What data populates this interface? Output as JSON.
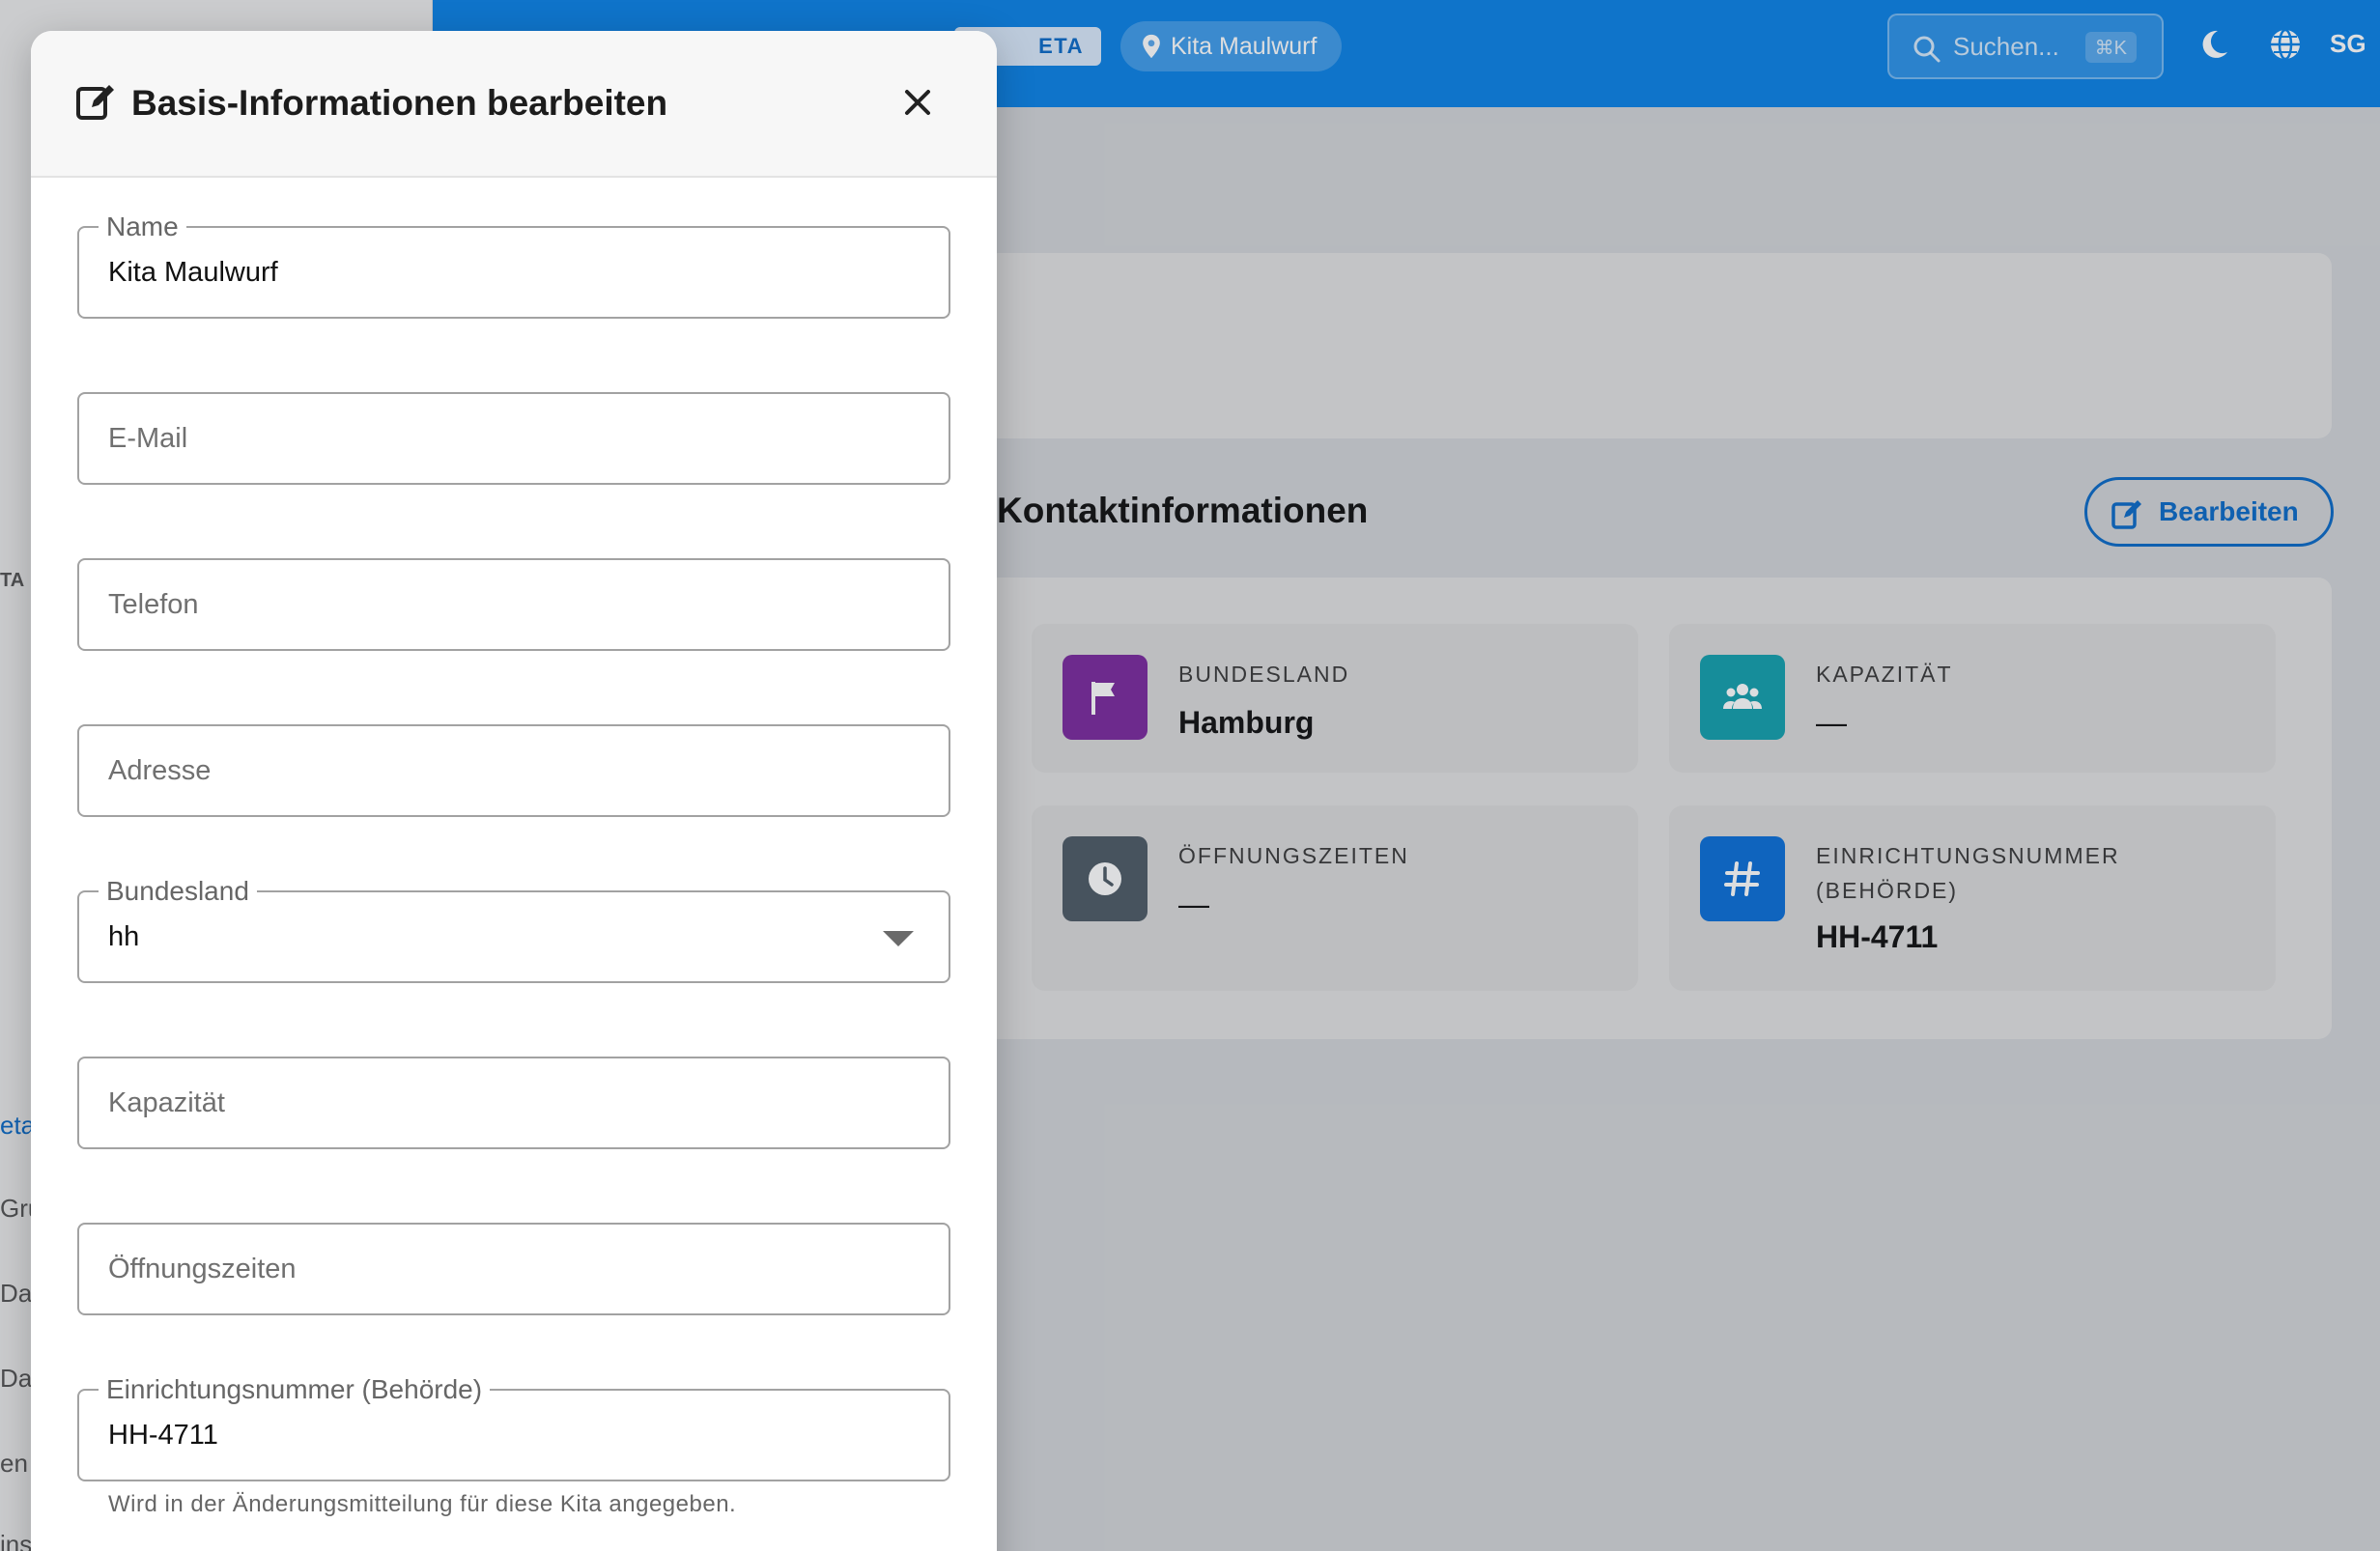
{
  "app": {
    "beta_label": "ETA",
    "location": "Kita Maulwurf",
    "search_placeholder": "Suchen...",
    "search_shortcut": "⌘K",
    "user_initials": "SG"
  },
  "sidebar": {
    "fragments": [
      "TA",
      "eta",
      "Gru",
      "Dat",
      "Dat",
      "en",
      "ins"
    ]
  },
  "main": {
    "section_title": "Kontaktinformationen",
    "edit_button_label": "Bearbeiten",
    "tiles": [
      {
        "label": "BUNDESLAND",
        "value": "Hamburg",
        "icon": "flag-icon",
        "color": "#7b2a9e"
      },
      {
        "label": "KAPAZITÄT",
        "value": "—",
        "icon": "group-icon",
        "color": "#14a0ad"
      },
      {
        "label": "ÖFFNUNGSZEITEN",
        "value": "—",
        "icon": "clock-icon",
        "color": "#4e5b66"
      },
      {
        "label": "EINRICHTUNGSNUMMER (BEHÖRDE)",
        "value": "HH-4711",
        "icon": "hash-icon",
        "color": "#0b6fd8"
      }
    ]
  },
  "modal": {
    "title": "Basis-Informationen bearbeiten",
    "fields": [
      {
        "label": "Name",
        "value": "Kita Maulwurf"
      },
      {
        "placeholder": "E-Mail"
      },
      {
        "placeholder": "Telefon"
      },
      {
        "placeholder": "Adresse"
      },
      {
        "label": "Bundesland",
        "value": "hh"
      },
      {
        "placeholder": "Kapazität"
      },
      {
        "placeholder": "Öffnungszeiten"
      },
      {
        "label": "Einrichtungsnummer (Behörde)",
        "value": "HH-4711"
      }
    ],
    "helper_text": "Wird in der Änderungsmitteilung für diese Kita angegeben."
  },
  "colors": {
    "appbar": "#0b82e6",
    "accent": "#0b6bc8"
  }
}
